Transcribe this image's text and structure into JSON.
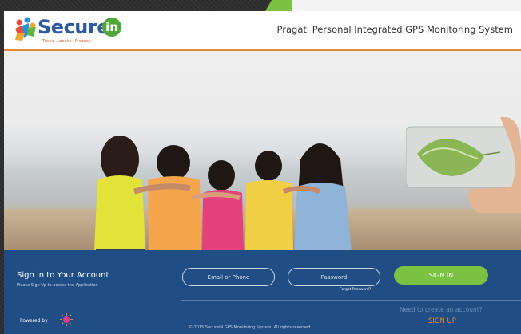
{
  "brand": {
    "name_prefix": "Secure",
    "name_badge": "in",
    "tagline": "Track. Locate. Protect."
  },
  "header": {
    "title": "Pragati Personal Integrated GPS Monitoring System"
  },
  "signin": {
    "title": "Sign in to Your Account",
    "subtitle": "Please Sign Up to access the Application",
    "email_placeholder": "Email or Phone",
    "password_placeholder": "Password",
    "forgot_label": "Forgot Password?",
    "signin_label": "SIGN IN",
    "need_account": "Need to create an account?",
    "signup_label": "SIGN UP"
  },
  "footer": {
    "powered_label": "Powered by :",
    "copyright": "© 2015 SecureIN GPS Monitoring System. All rights reserved."
  },
  "colors": {
    "accent_green": "#7cc242",
    "brand_blue": "#1f4d84",
    "orange": "#e88a2c"
  }
}
